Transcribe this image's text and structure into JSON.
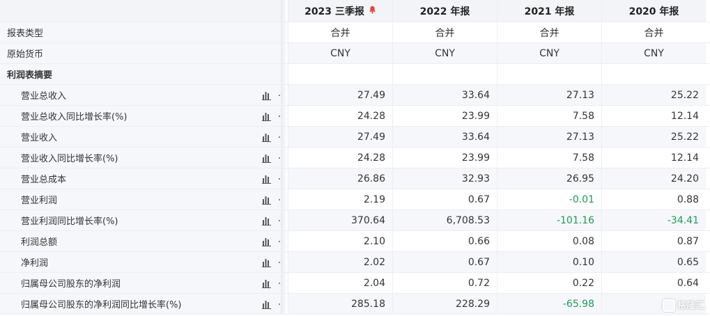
{
  "header": {
    "columns": [
      {
        "label": "2023 三季报",
        "has_bell": true
      },
      {
        "label": "2022 年报"
      },
      {
        "label": "2021 年报"
      },
      {
        "label": "2020 年报"
      }
    ]
  },
  "rows": [
    {
      "label": "报表类型",
      "values": [
        "合并",
        "合并",
        "合并",
        "合并"
      ],
      "type": "meta"
    },
    {
      "label": "原始货币",
      "values": [
        "CNY",
        "CNY",
        "CNY",
        "CNY"
      ],
      "type": "meta"
    },
    {
      "label": "利润表摘要",
      "values": [
        "",
        "",
        "",
        ""
      ],
      "type": "section"
    },
    {
      "label": "营业总收入",
      "values": [
        "27.49",
        "33.64",
        "27.13",
        "25.22"
      ],
      "type": "item"
    },
    {
      "label": "营业总收入同比增长率(%)",
      "values": [
        "24.28",
        "23.99",
        "7.58",
        "12.14"
      ],
      "type": "item"
    },
    {
      "label": "营业收入",
      "values": [
        "27.49",
        "33.64",
        "27.13",
        "25.22"
      ],
      "type": "item"
    },
    {
      "label": "营业收入同比增长率(%)",
      "values": [
        "24.28",
        "23.99",
        "7.58",
        "12.14"
      ],
      "type": "item"
    },
    {
      "label": "营业总成本",
      "values": [
        "26.86",
        "32.93",
        "26.95",
        "24.20"
      ],
      "type": "item"
    },
    {
      "label": "营业利润",
      "values": [
        "2.19",
        "0.67",
        "-0.01",
        "0.88"
      ],
      "type": "item"
    },
    {
      "label": "营业利润同比增长率(%)",
      "values": [
        "370.64",
        "6,708.53",
        "-101.16",
        "-34.41"
      ],
      "type": "item"
    },
    {
      "label": "利润总额",
      "values": [
        "2.10",
        "0.66",
        "0.08",
        "0.87"
      ],
      "type": "item"
    },
    {
      "label": "净利润",
      "values": [
        "2.02",
        "0.67",
        "0.10",
        "0.65"
      ],
      "type": "item"
    },
    {
      "label": "归属母公司股东的净利润",
      "values": [
        "2.04",
        "0.72",
        "0.22",
        "0.64"
      ],
      "type": "item"
    },
    {
      "label": "归属母公司股东的净利润同比增长率(%)",
      "values": [
        "285.18",
        "228.29",
        "-65.98",
        ""
      ],
      "type": "item"
    }
  ],
  "watermark": "格隆汇",
  "colors": {
    "negative": "#1b9a57",
    "label_bg": "#f6f7fb",
    "header_bg": "#f3f4f8",
    "bell": "#e8473a"
  }
}
